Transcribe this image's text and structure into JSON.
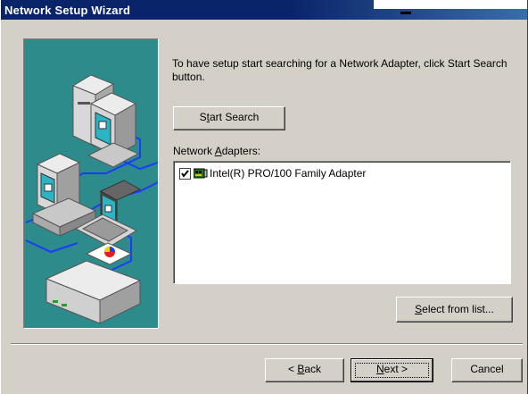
{
  "window": {
    "title": "Network Setup Wizard",
    "help_glyph": "?"
  },
  "intro": {
    "text": "To have setup start searching for a Network Adapter, click Start Search button."
  },
  "buttons": {
    "start_search": {
      "pre": "S",
      "mnemonic": "t",
      "post": "art Search"
    },
    "select_from_list": {
      "pre": "",
      "mnemonic": "S",
      "post": "elect from list..."
    },
    "back": {
      "pre": "< ",
      "mnemonic": "B",
      "post": "ack"
    },
    "next": {
      "pre": "",
      "mnemonic": "N",
      "post": "ext >"
    },
    "cancel": {
      "label": "Cancel"
    }
  },
  "adapters": {
    "label_pre": "Network ",
    "label_mnemonic": "A",
    "label_post": "dapters:",
    "items": [
      {
        "name": "Intel(R) PRO/100 Family Adapter",
        "checked": true,
        "icon": "network-card-icon"
      }
    ]
  },
  "colors": {
    "dialog_bg": "#d4d0c8",
    "titlebar": "#0a246a",
    "illustration_bg": "#2e8b8b"
  }
}
